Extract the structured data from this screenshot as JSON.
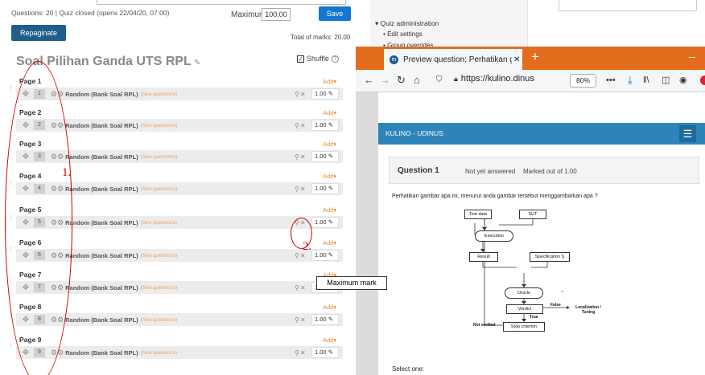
{
  "moodle": {
    "info_line": "Questions: 20 | Quiz closed (opens 22/04/20, 07:00)",
    "max_grade_label": "Maximum grade",
    "max_grade_value": "100.00",
    "save_label": "Save",
    "repaginate_label": "Repaginate",
    "total_marks": "Total of marks: 20.00",
    "quiz_title": "Soal Pilihan Ganda UTS RPL",
    "shuffle_label": "Shuffle",
    "add_label": "Add",
    "see_questions": "(See questions)",
    "question_name": "Random (Bank Soal RPL)",
    "pages": [
      {
        "label": "Page 1",
        "num": "1",
        "mark": "1.00"
      },
      {
        "label": "Page 2",
        "num": "2",
        "mark": "1.00"
      },
      {
        "label": "Page 3",
        "num": "3",
        "mark": "1.00"
      },
      {
        "label": "Page 4",
        "num": "4",
        "mark": "1.00"
      },
      {
        "label": "Page 5",
        "num": "5",
        "mark": "1.00"
      },
      {
        "label": "Page 6",
        "num": "6",
        "mark": "1.00"
      },
      {
        "label": "Page 7",
        "num": "7",
        "mark": "1.00"
      },
      {
        "label": "Page 8",
        "num": "8",
        "mark": "1.00"
      },
      {
        "label": "Page 9",
        "num": "9",
        "mark": "1.00"
      }
    ],
    "tooltip": "Maximum mark"
  },
  "annotations": {
    "n1": "1.",
    "n2": "2."
  },
  "admin": {
    "title": "Quiz administration",
    "items": [
      "Edit settings",
      "Group overrides"
    ]
  },
  "browser": {
    "tab_title": "Preview question: Perhatikan g",
    "url_main": "https://kulino.dinus",
    "zoom": "80%"
  },
  "preview": {
    "site_title": "KULINO - UDINUS",
    "question_title": "Question 1",
    "status": "Not yet answered",
    "marked": "Marked out of 1.00",
    "question_text": "Perhatikan gambar apa ini, menurut anda gambar tersebut menggambarkan apa ?",
    "select_one": "Select one:",
    "diagram": {
      "test_data": "Test data",
      "sut": "SUT",
      "execution": "Execution",
      "result": "Result",
      "spec": "Specification S",
      "oracle": "Oracle",
      "verdict": "Verdict",
      "false_lbl": "False",
      "true_lbl": "True",
      "localization": "Localization / Tuning",
      "not_verified": "Not verified",
      "stop": "Stop criterion"
    }
  },
  "colors": {
    "firefox_orange": "#e36d1c",
    "moodle_blue": "#1177d1",
    "kulino_blue": "#2e84b9",
    "annotation_red": "#cc0000",
    "add_orange": "#f18a2e"
  }
}
